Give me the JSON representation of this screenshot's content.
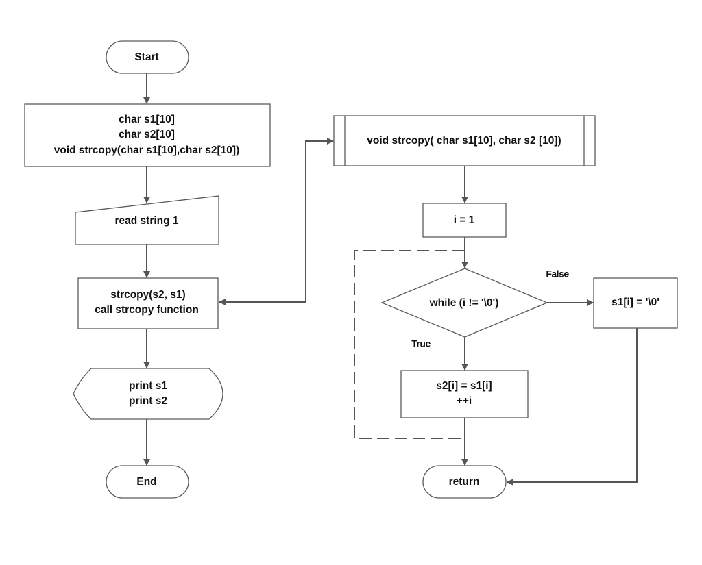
{
  "nodes": {
    "start": "Start",
    "declarations": [
      "char s1[10]",
      "char s2[10]",
      "void strcopy(char s1[10],char s2[10])"
    ],
    "read": "read string 1",
    "call": [
      "strcopy(s2, s1)",
      "call strcopy function"
    ],
    "print": [
      "print s1",
      "print s2"
    ],
    "end": "End",
    "function": "void strcopy( char s1[10], char s2 [10])",
    "init": "i = 1",
    "condition": "while (i != '\\0')",
    "terminate": "s1[i] = '\\0'",
    "body": [
      "s2[i] = s1[i]",
      "++i"
    ],
    "return": "return"
  },
  "edge_labels": {
    "false": "False",
    "true": "True"
  },
  "colors": {
    "stroke": "#555555",
    "fill": "#ffffff"
  }
}
